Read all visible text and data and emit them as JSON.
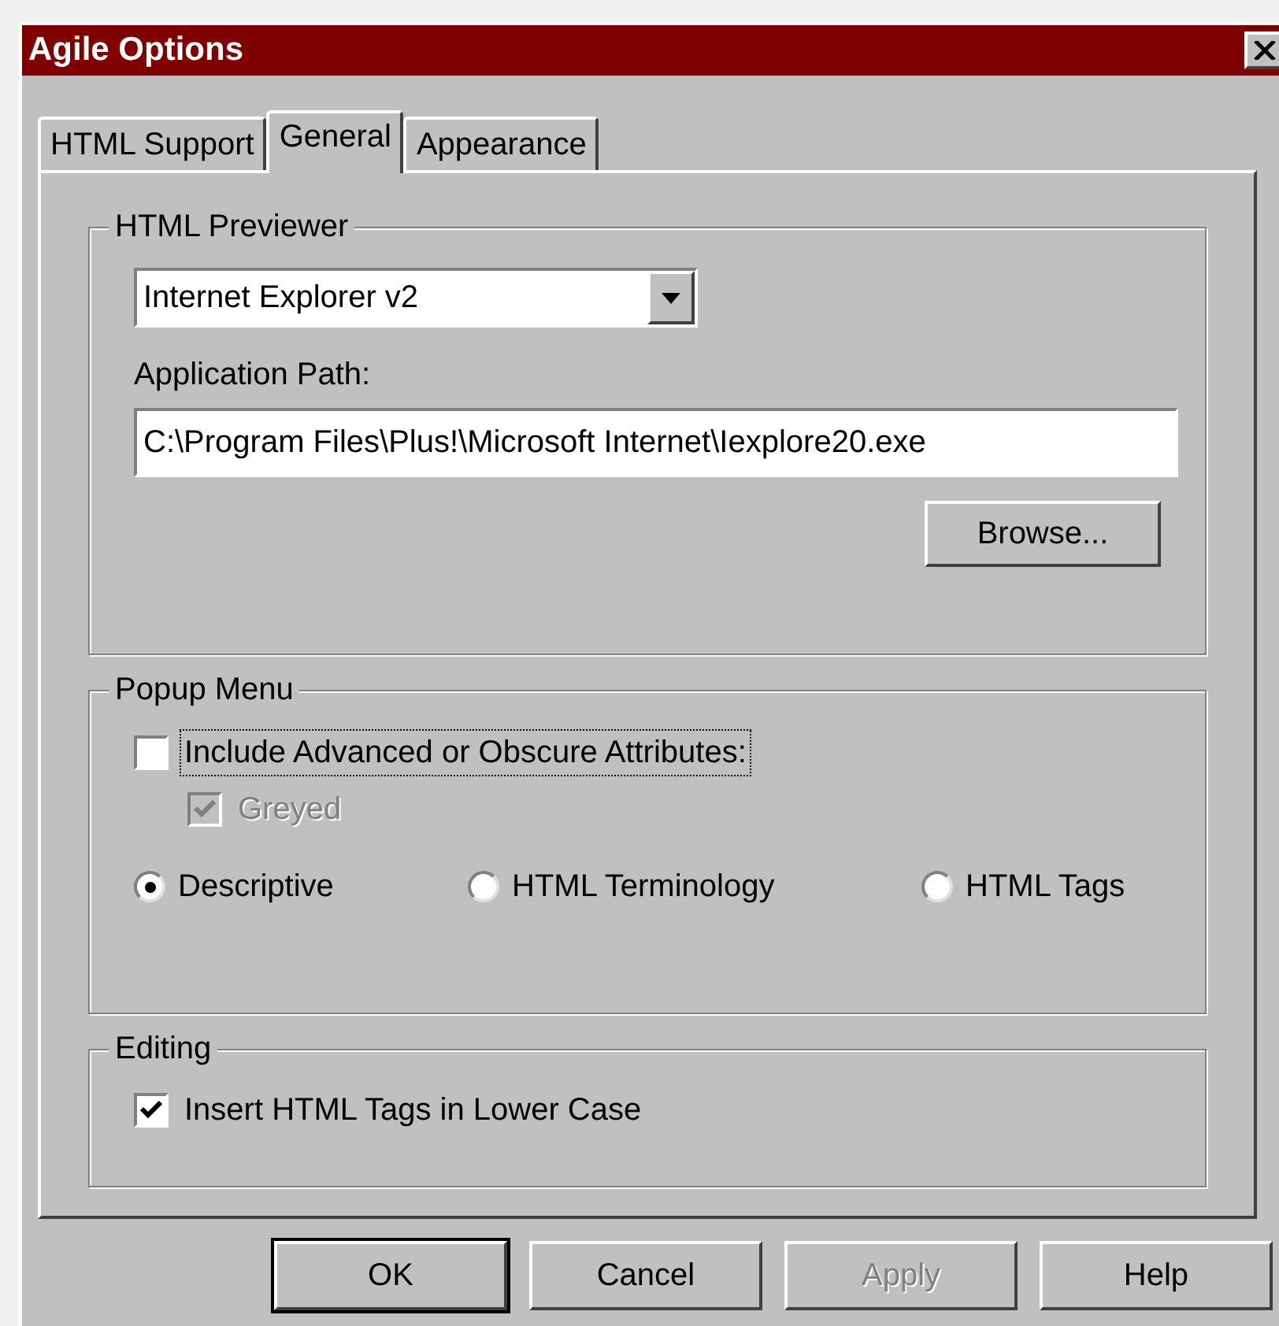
{
  "window": {
    "title": "Agile Options"
  },
  "tabs": [
    {
      "label": "HTML Support",
      "selected": false
    },
    {
      "label": "General",
      "selected": true
    },
    {
      "label": "Appearance",
      "selected": false
    }
  ],
  "html_previewer": {
    "title": "HTML Previewer",
    "previewer": "Internet Explorer v2",
    "path_label": "Application Path:",
    "path": "C:\\Program Files\\Plus!\\Microsoft Internet\\Iexplore20.exe",
    "browse": "Browse..."
  },
  "popup_menu": {
    "title": "Popup Menu",
    "checkboxes": [
      {
        "label": "Include Advanced or Obscure Attributes:",
        "checked": false,
        "disabled": false,
        "focused": true
      },
      {
        "label": "Greyed",
        "checked": true,
        "disabled": true,
        "focused": false
      }
    ],
    "options": [
      {
        "label": "Descriptive",
        "selected": true
      },
      {
        "label": "HTML Terminology",
        "selected": false
      },
      {
        "label": "HTML Tags",
        "selected": false
      }
    ]
  },
  "editing": {
    "title": "Editing",
    "checkboxes": [
      {
        "label": "Insert HTML Tags in Lower Case",
        "checked": true,
        "disabled": false,
        "focused": false
      }
    ]
  },
  "buttons": [
    {
      "label": "OK",
      "default": true,
      "disabled": false
    },
    {
      "label": "Cancel",
      "default": false,
      "disabled": false
    },
    {
      "label": "Apply",
      "default": false,
      "disabled": true
    },
    {
      "label": "Help",
      "default": false,
      "disabled": false
    }
  ]
}
